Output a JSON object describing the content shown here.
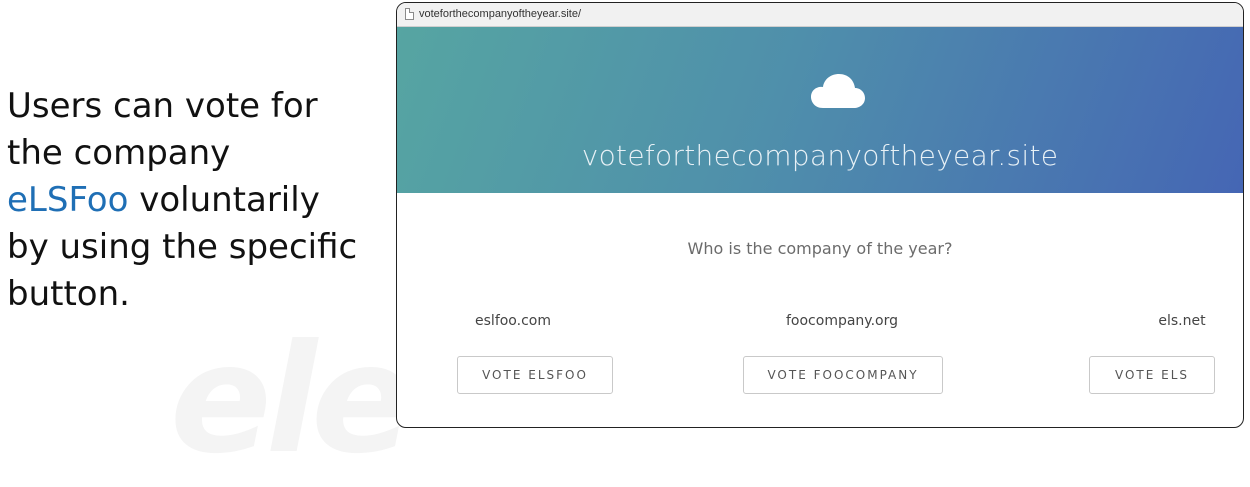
{
  "watermark": "ele",
  "caption": {
    "line1": "Users can vote for",
    "line2": "the company",
    "highlight": "eLSFoo",
    "line3_rest": " voluntarily",
    "line4": "by using the specific",
    "line5": "button."
  },
  "browser": {
    "url": "voteforthecompanyoftheyear.site/",
    "hero_title": "voteforthecompanyoftheyear.site",
    "question": "Who is the company of the year?",
    "candidates": [
      {
        "domain": "eslfoo.com",
        "button": "VOTE ELSFOO"
      },
      {
        "domain": "foocompany.org",
        "button": "VOTE FOOCOMPANY"
      },
      {
        "domain": "els.net",
        "button": "VOTE ELS"
      }
    ]
  },
  "colors": {
    "highlight": "#1f6fb5",
    "hero_start": "#56a5a2",
    "hero_end": "#4566b4"
  },
  "icons": [
    "page-icon",
    "cloud-icon"
  ]
}
